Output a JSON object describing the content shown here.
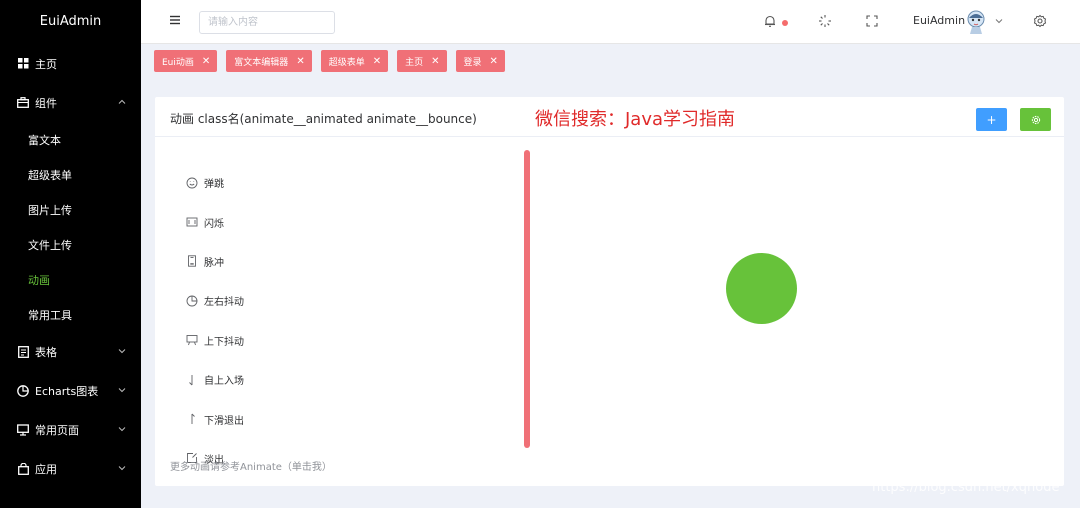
{
  "sidebar": {
    "brand": "EuiAdmin",
    "items": [
      {
        "label": "主页",
        "icon": "grid-icon"
      },
      {
        "label": "组件",
        "icon": "briefcase-icon",
        "expanded": true
      },
      {
        "label": "表格",
        "icon": "document-icon"
      },
      {
        "label": "Echarts图表",
        "icon": "pie-chart-icon"
      },
      {
        "label": "常用页面",
        "icon": "monitor-icon"
      },
      {
        "label": "应用",
        "icon": "bag-icon"
      }
    ],
    "submenu": [
      "富文本",
      "超级表单",
      "图片上传",
      "文件上传",
      "动画",
      "常用工具"
    ],
    "active_sub": "动画"
  },
  "header": {
    "search_placeholder": "请输入内容",
    "user_name": "EuiAdmin"
  },
  "tags": [
    "Eui动画",
    "富文本编辑器",
    "超级表单",
    "主页",
    "登录"
  ],
  "card": {
    "title": "动画 class名(animate__animated animate__bounce)",
    "overlay_text": "微信搜索：Java学习指南",
    "add_label": "+",
    "settings_icon": "gear-icon",
    "animations": [
      {
        "label": "弹跳",
        "icon": "smile-icon"
      },
      {
        "label": "闪烁",
        "icon": "film-icon"
      },
      {
        "label": "脉冲",
        "icon": "phone-icon"
      },
      {
        "label": "左右抖动",
        "icon": "pie-icon"
      },
      {
        "label": "上下抖动",
        "icon": "presentation-icon"
      },
      {
        "label": "自上入场",
        "icon": "arrow-down-icon"
      },
      {
        "label": "下滑退出",
        "icon": "arrow-up-icon"
      },
      {
        "label": "淡出",
        "icon": "share-icon"
      }
    ],
    "more_link": "更多动画请参考Animate（单击我）"
  },
  "watermark": "https://blog.csdn.net/xqnode",
  "colors": {
    "accent_green": "#67c23a",
    "tag_red": "#f07077",
    "primary_blue": "#409eff"
  }
}
